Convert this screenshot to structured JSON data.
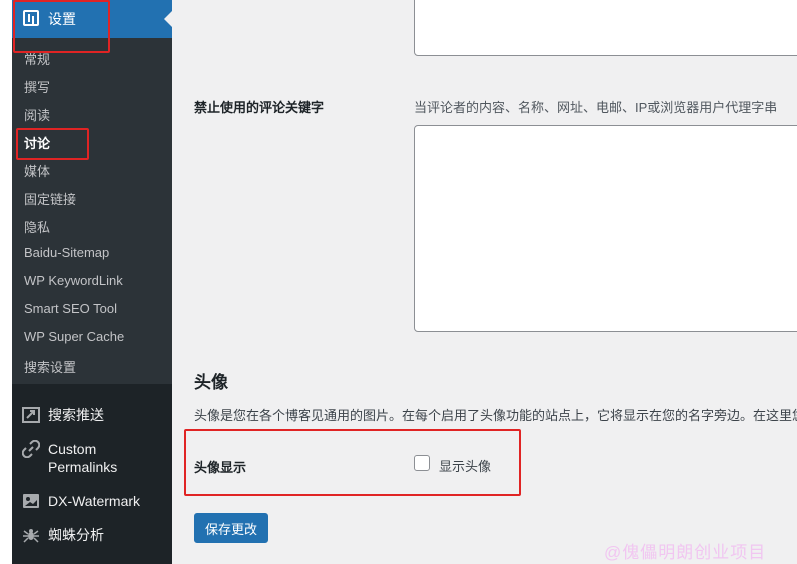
{
  "sidebar": {
    "settings_label": "设置",
    "submenu": [
      "常规",
      "撰写",
      "阅读",
      "讨论",
      "媒体",
      "固定链接",
      "隐私",
      "Baidu-Sitemap",
      "WP KeywordLink",
      "Smart SEO Tool",
      "WP Super Cache",
      "搜索设置"
    ],
    "active_sub": "讨论",
    "items": [
      {
        "label": "搜索推送",
        "icon": "push-icon"
      },
      {
        "label": "Custom Permalinks",
        "label_line1": "Custom",
        "label_line2": "Permalinks",
        "icon": "link-icon"
      },
      {
        "label": "DX-Watermark",
        "icon": "watermark-icon"
      },
      {
        "label": "蜘蛛分析",
        "icon": "spider-icon"
      }
    ]
  },
  "main": {
    "blocklist_label": "禁止使用的评论关键字",
    "blocklist_desc": "当评论者的内容、名称、网址、电邮、IP或浏览器用户代理字串",
    "avatar_title": "头像",
    "avatar_desc": "头像是您在各个博客见通用的图片。在每个启用了头像功能的站点上，它将显示在您的名字旁边。在这里您",
    "avatar_display_label": "头像显示",
    "show_avatars_label": "显示头像",
    "show_avatars_checked": false,
    "save_label": "保存更改"
  },
  "watermark": "@傀儡明朗创业项目",
  "colors": {
    "accent": "#2271b1",
    "annotation": "#e02424",
    "sidebar_bg": "#1d2327"
  }
}
